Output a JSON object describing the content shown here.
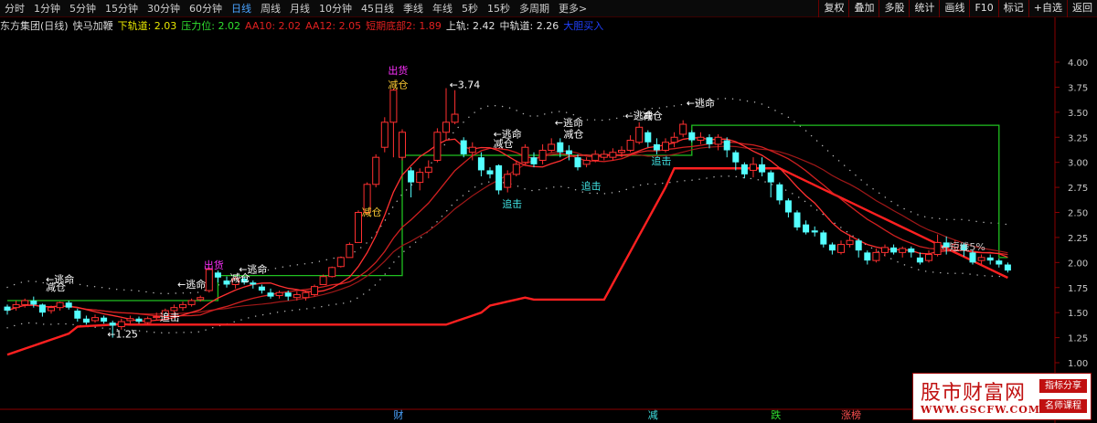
{
  "toolbar": {
    "tabs": [
      "分时",
      "1分钟",
      "5分钟",
      "15分钟",
      "30分钟",
      "60分钟",
      "日线",
      "周线",
      "月线",
      "10分钟",
      "45日线",
      "季线",
      "年线",
      "5秒",
      "15秒",
      "多周期",
      "更多>"
    ],
    "active_index": 6,
    "right_buttons": [
      "复权",
      "叠加",
      "多股",
      "统计",
      "画线",
      "F10",
      "标记",
      "+自选",
      "返回"
    ]
  },
  "legend": {
    "stock": "东方集团(日线)",
    "indicator": "快马加鞭",
    "items": [
      {
        "label": "下轨道: 2.03",
        "color": "#e8e800"
      },
      {
        "label": "压力位: 2.02",
        "color": "#30e030"
      },
      {
        "label": "AA10: 2.02",
        "color": "#e02020"
      },
      {
        "label": "AA12: 2.05",
        "color": "#e02020"
      },
      {
        "label": "短期底部2: 1.89",
        "color": "#e02020"
      },
      {
        "label": "上轨: 2.42",
        "color": "#e0e0e0"
      },
      {
        "label": "中轨道: 2.26",
        "color": "#e0e0e0"
      },
      {
        "label": "大胆买入",
        "color": "#2040ff"
      }
    ]
  },
  "chart_data": {
    "type": "candlestick",
    "yticks": [
      "4.00",
      "3.75",
      "3.50",
      "3.25",
      "3.00",
      "2.75",
      "2.50",
      "2.25",
      "2.00",
      "1.75",
      "1.50",
      "1.25",
      "1.00"
    ],
    "ylim": [
      1.0,
      4.0
    ],
    "candles": [
      [
        1.56,
        1.52,
        1.58,
        1.48
      ],
      [
        1.55,
        1.58,
        1.62,
        1.52
      ],
      [
        1.58,
        1.62,
        1.64,
        1.55
      ],
      [
        1.62,
        1.58,
        1.66,
        1.55
      ],
      [
        1.58,
        1.5,
        1.59,
        1.46
      ],
      [
        1.52,
        1.55,
        1.57,
        1.49
      ],
      [
        1.55,
        1.6,
        1.61,
        1.52
      ],
      [
        1.6,
        1.55,
        1.62,
        1.53
      ],
      [
        1.52,
        1.44,
        1.54,
        1.41
      ],
      [
        1.44,
        1.4,
        1.47,
        1.38
      ],
      [
        1.42,
        1.45,
        1.48,
        1.4
      ],
      [
        1.45,
        1.41,
        1.47,
        1.39
      ],
      [
        1.4,
        1.37,
        1.42,
        1.25
      ],
      [
        1.36,
        1.41,
        1.44,
        1.33
      ],
      [
        1.42,
        1.44,
        1.47,
        1.39
      ],
      [
        1.44,
        1.41,
        1.46,
        1.39
      ],
      [
        1.4,
        1.44,
        1.46,
        1.38
      ],
      [
        1.45,
        1.46,
        1.5,
        1.42
      ],
      [
        1.46,
        1.52,
        1.54,
        1.44
      ],
      [
        1.52,
        1.55,
        1.58,
        1.5
      ],
      [
        1.55,
        1.58,
        1.61,
        1.52
      ],
      [
        1.58,
        1.62,
        1.64,
        1.56
      ],
      [
        1.63,
        1.65,
        1.67,
        1.61
      ],
      [
        1.72,
        1.93,
        1.95,
        1.7
      ],
      [
        1.9,
        1.85,
        1.92,
        1.8
      ],
      [
        1.82,
        1.78,
        1.86,
        1.75
      ],
      [
        1.78,
        1.84,
        1.86,
        1.74
      ],
      [
        1.84,
        1.8,
        1.86,
        1.78
      ],
      [
        1.8,
        1.78,
        1.82,
        1.74
      ],
      [
        1.76,
        1.72,
        1.78,
        1.69
      ],
      [
        1.7,
        1.66,
        1.74,
        1.64
      ],
      [
        1.67,
        1.7,
        1.72,
        1.64
      ],
      [
        1.7,
        1.66,
        1.72,
        1.62
      ],
      [
        1.65,
        1.68,
        1.71,
        1.62
      ],
      [
        1.65,
        1.7,
        1.72,
        1.62
      ],
      [
        1.68,
        1.76,
        1.78,
        1.66
      ],
      [
        1.78,
        1.86,
        1.88,
        1.78
      ],
      [
        1.86,
        1.95,
        1.96,
        1.85
      ],
      [
        1.96,
        2.05,
        2.06,
        1.95
      ],
      [
        2.05,
        2.18,
        2.2,
        2.05
      ],
      [
        2.2,
        2.5,
        2.52,
        2.2
      ],
      [
        2.5,
        2.78,
        2.8,
        2.48
      ],
      [
        2.78,
        3.05,
        3.08,
        2.75
      ],
      [
        3.15,
        3.4,
        3.45,
        3.1
      ],
      [
        3.4,
        3.72,
        3.74,
        3.05
      ],
      [
        3.05,
        3.3,
        3.33,
        3.02
      ],
      [
        2.92,
        2.8,
        2.95,
        2.65
      ],
      [
        2.8,
        2.9,
        2.94,
        2.72
      ],
      [
        2.9,
        2.95,
        3.02,
        2.84
      ],
      [
        3.02,
        3.3,
        3.34,
        3.0
      ],
      [
        3.3,
        3.4,
        3.74,
        3.22
      ],
      [
        3.4,
        3.48,
        3.72,
        3.38
      ],
      [
        3.22,
        3.08,
        3.25,
        3.05
      ],
      [
        3.1,
        3.15,
        3.2,
        3.02
      ],
      [
        3.05,
        2.92,
        3.1,
        2.86
      ],
      [
        2.92,
        2.88,
        2.95,
        2.84
      ],
      [
        2.97,
        2.72,
        2.98,
        2.68
      ],
      [
        2.75,
        2.88,
        2.92,
        2.7
      ],
      [
        2.88,
        2.98,
        3.02,
        2.86
      ],
      [
        3.0,
        3.15,
        3.18,
        2.98
      ],
      [
        3.05,
        2.98,
        3.1,
        2.95
      ],
      [
        3.02,
        3.12,
        3.18,
        2.98
      ],
      [
        3.12,
        3.18,
        3.24,
        3.1
      ],
      [
        3.2,
        3.1,
        3.24,
        3.05
      ],
      [
        3.12,
        3.08,
        3.17,
        3.02
      ],
      [
        3.05,
        2.95,
        3.08,
        2.92
      ],
      [
        2.98,
        3.02,
        3.05,
        2.95
      ],
      [
        3.02,
        3.08,
        3.12,
        3.0
      ],
      [
        3.05,
        3.08,
        3.12,
        3.02
      ],
      [
        3.05,
        3.1,
        3.14,
        3.02
      ],
      [
        3.1,
        3.12,
        3.16,
        3.05
      ],
      [
        3.12,
        3.22,
        3.27,
        3.1
      ],
      [
        3.2,
        3.35,
        3.4,
        3.18
      ],
      [
        3.3,
        3.2,
        3.32,
        3.15
      ],
      [
        3.18,
        3.12,
        3.24,
        3.08
      ],
      [
        3.12,
        3.2,
        3.24,
        3.1
      ],
      [
        3.2,
        3.25,
        3.3,
        3.15
      ],
      [
        3.28,
        3.38,
        3.42,
        3.25
      ],
      [
        3.3,
        3.22,
        3.32,
        3.2
      ],
      [
        3.22,
        3.25,
        3.3,
        3.18
      ],
      [
        3.25,
        3.18,
        3.28,
        3.14
      ],
      [
        3.18,
        3.25,
        3.28,
        3.12
      ],
      [
        3.22,
        3.12,
        3.25,
        3.05
      ],
      [
        3.1,
        3.0,
        3.12,
        2.92
      ],
      [
        2.98,
        2.88,
        3.0,
        2.84
      ],
      [
        2.92,
        2.98,
        3.05,
        2.85
      ],
      [
        2.98,
        2.9,
        3.05,
        2.86
      ],
      [
        2.9,
        2.8,
        2.92,
        2.65
      ],
      [
        2.78,
        2.62,
        2.8,
        2.58
      ],
      [
        2.62,
        2.5,
        2.64,
        2.45
      ],
      [
        2.5,
        2.35,
        2.52,
        2.32
      ],
      [
        2.38,
        2.3,
        2.42,
        2.28
      ],
      [
        2.32,
        2.3,
        2.36,
        2.26
      ],
      [
        2.3,
        2.18,
        2.32,
        2.15
      ],
      [
        2.18,
        2.12,
        2.2,
        2.08
      ],
      [
        2.1,
        2.18,
        2.22,
        2.08
      ],
      [
        2.18,
        2.22,
        2.28,
        2.15
      ],
      [
        2.22,
        2.12,
        2.24,
        2.05
      ],
      [
        2.1,
        2.02,
        2.12,
        1.98
      ],
      [
        2.02,
        2.1,
        2.14,
        2.0
      ],
      [
        2.1,
        2.15,
        2.18,
        2.06
      ],
      [
        2.15,
        2.1,
        2.18,
        2.08
      ],
      [
        2.1,
        2.14,
        2.16,
        2.05
      ],
      [
        2.14,
        2.1,
        2.16,
        2.05
      ],
      [
        2.05,
        2.0,
        2.1,
        1.98
      ],
      [
        2.02,
        2.08,
        2.12,
        2.0
      ],
      [
        2.08,
        2.2,
        2.28,
        2.06
      ],
      [
        2.2,
        2.15,
        2.26,
        2.08
      ],
      [
        2.15,
        2.18,
        2.22,
        2.1
      ],
      [
        2.18,
        2.12,
        2.2,
        2.06
      ],
      [
        2.1,
        2.0,
        2.12,
        1.98
      ],
      [
        2.02,
        2.05,
        2.08,
        1.98
      ],
      [
        2.05,
        2.02,
        2.08,
        1.98
      ],
      [
        2.02,
        1.98,
        2.04,
        1.95
      ],
      [
        1.98,
        1.92,
        2.0,
        1.9
      ]
    ],
    "annotations": [
      {
        "text": "←逃命",
        "i": 5,
        "y": 1.8,
        "color": "#ffffff"
      },
      {
        "text": "减仓",
        "i": 5,
        "y": 1.72,
        "color": "#ffffff"
      },
      {
        "text": "←1.25",
        "i": 12,
        "y": 1.25,
        "color": "#ffffff"
      },
      {
        "text": "追击",
        "i": 18,
        "y": 1.42,
        "color": "#ffffff"
      },
      {
        "text": "←逃命",
        "i": 20,
        "y": 1.75,
        "color": "#ffffff"
      },
      {
        "text": "出货",
        "i": 23,
        "y": 1.94,
        "color": "#ff30ff"
      },
      {
        "text": "←逃命",
        "i": 27,
        "y": 1.9,
        "color": "#ffffff"
      },
      {
        "text": "减仓",
        "i": 26,
        "y": 1.81,
        "color": "#ffffff"
      },
      {
        "text": "减仓",
        "i": 41,
        "y": 2.47,
        "color": "#ffcc33"
      },
      {
        "text": "出货",
        "i": 44,
        "y": 3.88,
        "color": "#ff30ff"
      },
      {
        "text": "减仓",
        "i": 44,
        "y": 3.74,
        "color": "#ffcc33"
      },
      {
        "text": "←3.74",
        "i": 51,
        "y": 3.74,
        "color": "#ffffff"
      },
      {
        "text": "←逃命",
        "i": 56,
        "y": 3.25,
        "color": "#ffffff"
      },
      {
        "text": "减仓",
        "i": 56,
        "y": 3.15,
        "color": "#ffffff"
      },
      {
        "text": "追击",
        "i": 57,
        "y": 2.55,
        "color": "#40e0e0"
      },
      {
        "text": "←逃命",
        "i": 63,
        "y": 3.36,
        "color": "#ffffff"
      },
      {
        "text": "减仓",
        "i": 64,
        "y": 3.25,
        "color": "#ffffff"
      },
      {
        "text": "追击",
        "i": 66,
        "y": 2.73,
        "color": "#40e0e0"
      },
      {
        "text": "←逃命",
        "i": 71,
        "y": 3.43,
        "color": "#ffffff"
      },
      {
        "text": "减仓",
        "i": 73,
        "y": 3.43,
        "color": "#ffffff"
      },
      {
        "text": "追击",
        "i": 74,
        "y": 2.98,
        "color": "#40e0e0"
      },
      {
        "text": "←逃命",
        "i": 78,
        "y": 3.56,
        "color": "#ffffff"
      },
      {
        "text": "←短线5%",
        "i": 107,
        "y": 2.12,
        "color": "#c8c8c8"
      }
    ],
    "bottom_labels": [
      {
        "text": "财",
        "i": 44,
        "color": "#4aa3ff"
      },
      {
        "text": "减",
        "i": 73,
        "color": "#40e0e0"
      },
      {
        "text": "跌",
        "i": 87,
        "color": "#30e030"
      },
      {
        "text": "涨榜",
        "i": 95,
        "color": "#ff5050"
      }
    ]
  },
  "watermark": {
    "title": "股市财富网",
    "url": "WWW.GSCFW.COM",
    "badge_top": "指标分享",
    "badge_bottom": "名师课程"
  }
}
